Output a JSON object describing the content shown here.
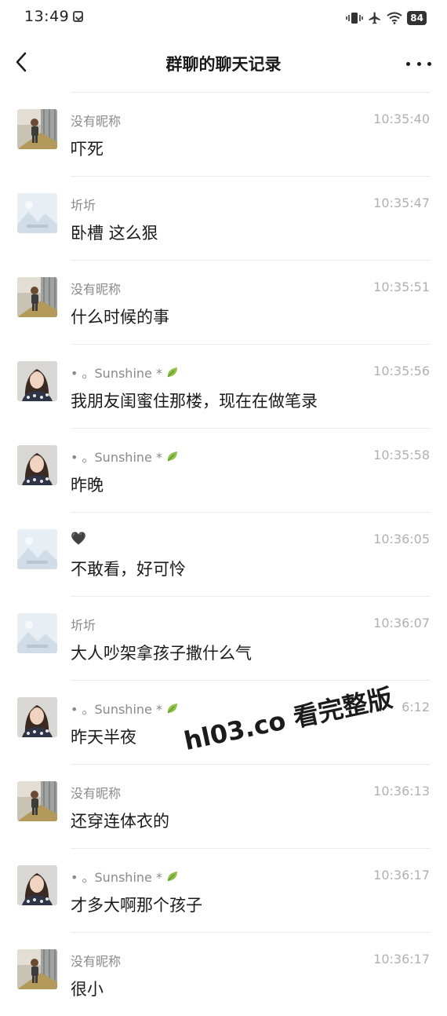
{
  "status_bar": {
    "time": "13:49",
    "battery": "84"
  },
  "header": {
    "title": "群聊的聊天记录"
  },
  "messages": [
    {
      "sender": "没有昵称",
      "time": "10:35:40",
      "text": "吓死",
      "avatar": "child"
    },
    {
      "sender": "圻圻",
      "time": "10:35:47",
      "text": "卧槽 这么狠",
      "avatar": "placeholder"
    },
    {
      "sender": "没有昵称",
      "time": "10:35:51",
      "text": "什么时候的事",
      "avatar": "child"
    },
    {
      "sender": "• 。Sunshine *",
      "time": "10:35:56",
      "text": "我朋友闺蜜住那楼，现在在做笔录",
      "avatar": "woman"
    },
    {
      "sender": "• 。Sunshine *",
      "time": "10:35:58",
      "text": "昨晚",
      "avatar": "woman"
    },
    {
      "sender": "🖤",
      "time": "10:36:05",
      "text": "不敢看，好可怜",
      "avatar": "placeholder"
    },
    {
      "sender": "圻圻",
      "time": "10:36:07",
      "text": "大人吵架拿孩子撒什么气",
      "avatar": "placeholder"
    },
    {
      "sender": "• 。Sunshine *",
      "time": "6:12",
      "text": "昨天半夜",
      "avatar": "woman"
    },
    {
      "sender": "没有昵称",
      "time": "10:36:13",
      "text": "还穿连体衣的",
      "avatar": "child"
    },
    {
      "sender": "• 。Sunshine *",
      "time": "10:36:17",
      "text": "才多大啊那个孩子",
      "avatar": "woman"
    },
    {
      "sender": "没有昵称",
      "time": "10:36:17",
      "text": "很小",
      "avatar": "child"
    }
  ],
  "watermark": "hl03.co 看完整版",
  "icons": {
    "back": "chevron-left-icon",
    "more": "more-dots-icon",
    "sender_badge": "leaf-icon"
  },
  "colors": {
    "timestamp": "#b0b0b0",
    "sender": "#8a8a8a",
    "leaf": "#8fc14a"
  }
}
